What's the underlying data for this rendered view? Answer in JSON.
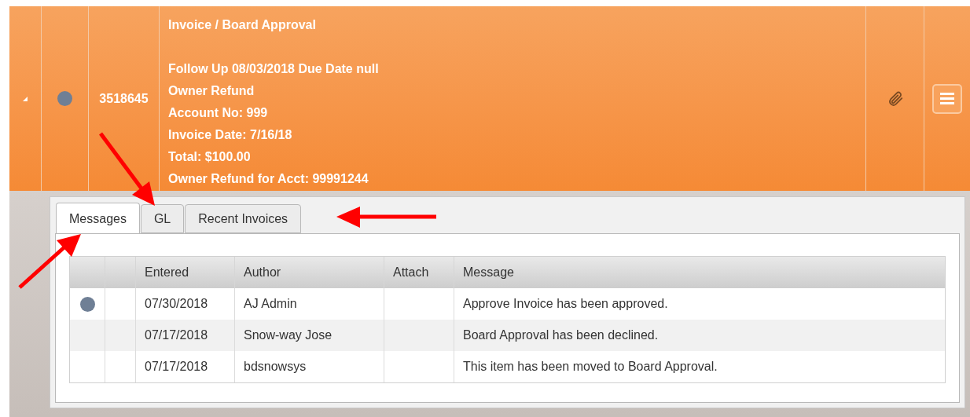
{
  "item": {
    "expanded": true,
    "flagged": true,
    "number": "3518645",
    "title": "Invoice / Board Approval",
    "lines": [
      "Follow Up 08/03/2018 Due Date null",
      "Owner Refund",
      "Account No: 999",
      "Invoice Date: 7/16/18",
      "Total: $100.00",
      "Owner Refund for Acct: 99991244"
    ],
    "has_attachment": true
  },
  "tabs": [
    {
      "label": "Messages",
      "selected": true
    },
    {
      "label": "GL",
      "selected": false
    },
    {
      "label": "Recent Invoices",
      "selected": false
    }
  ],
  "table": {
    "columns": [
      "",
      "",
      "Entered",
      "Author",
      "Attach",
      "Message"
    ],
    "rows": [
      {
        "unread": true,
        "entered": "07/30/2018",
        "author": "AJ Admin",
        "message": "Approve Invoice has been approved."
      },
      {
        "unread": false,
        "entered": "07/17/2018",
        "author": "Snow-way Jose",
        "message": "Board Approval has been declined."
      },
      {
        "unread": false,
        "entered": "07/17/2018",
        "author": "bdsnowsys",
        "message": "This item has been moved to Board Approval."
      }
    ]
  }
}
